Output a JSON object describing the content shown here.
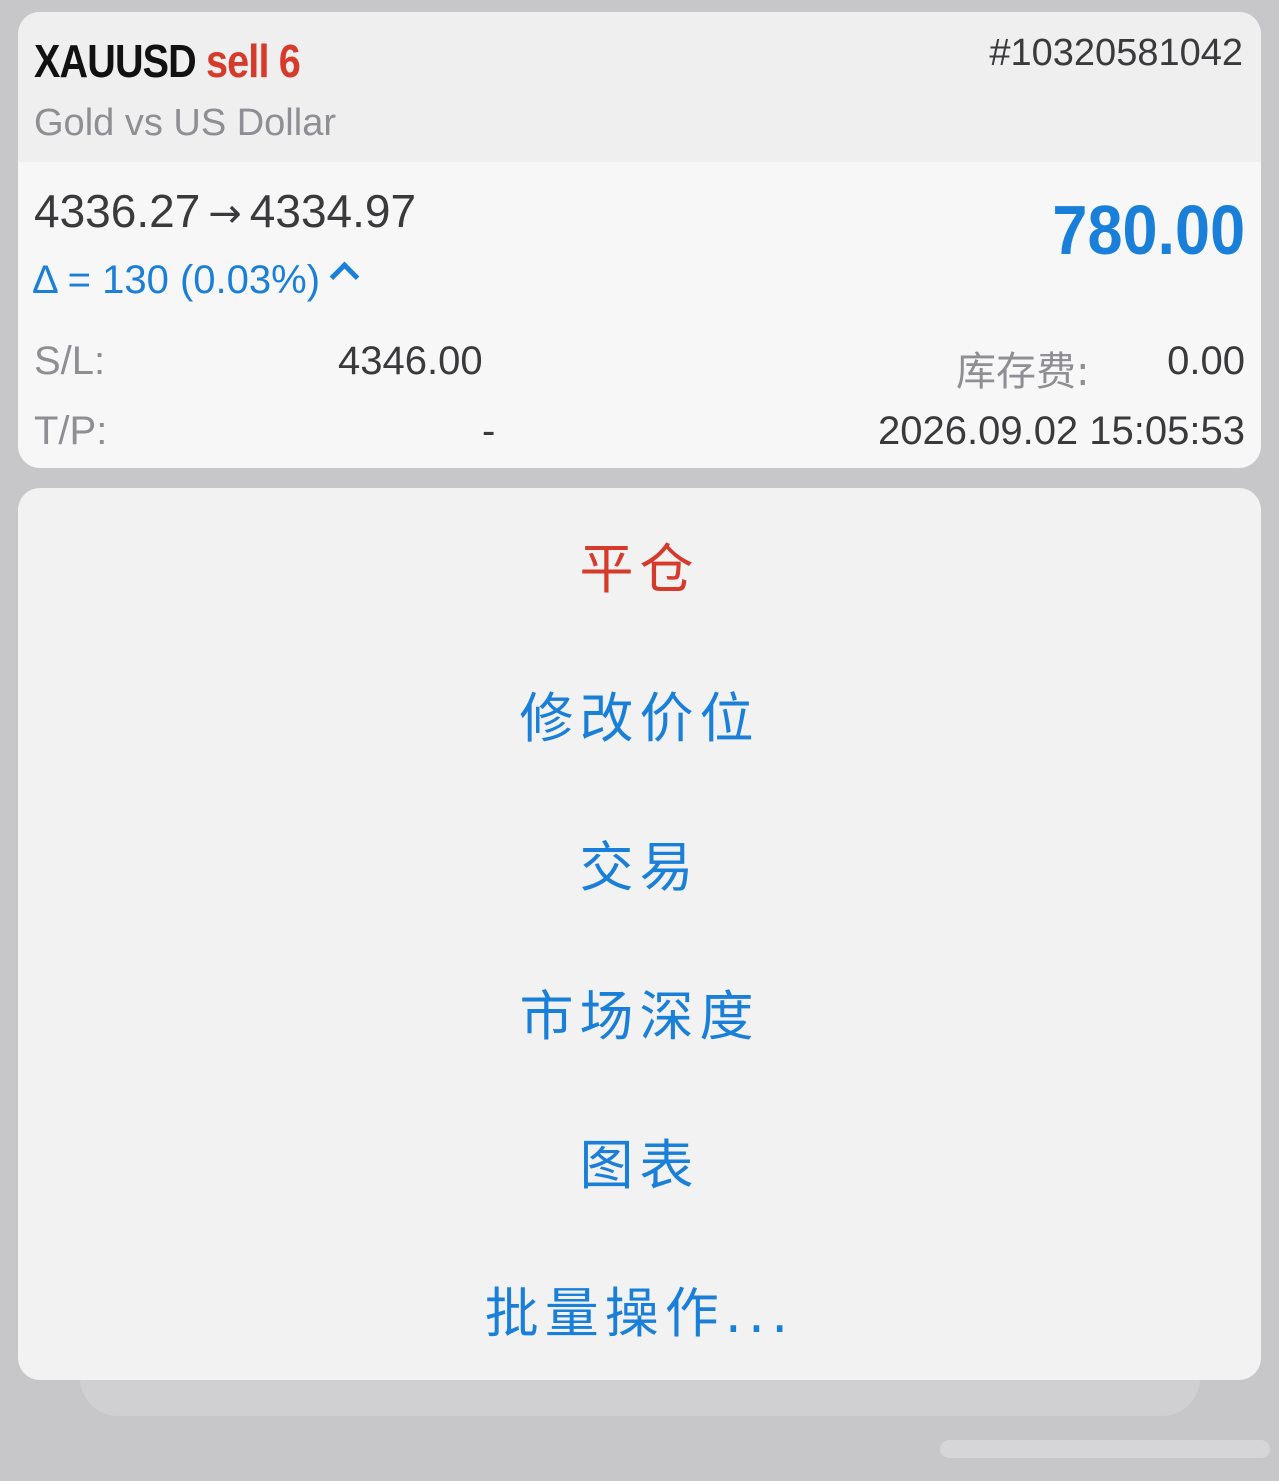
{
  "position": {
    "symbol": "XAUUSD",
    "side_volume": "sell 6",
    "ticket": "#10320581042",
    "description": "Gold vs US Dollar",
    "open_price": "4336.27",
    "arrow": "→",
    "current_price": "4334.97",
    "delta": "Δ = 130 (0.03%)",
    "profit": "780.00",
    "sl_label": "S/L:",
    "sl_value": "4346.00",
    "tp_label": "T/P:",
    "tp_value": "-",
    "swap_label": "库存费:",
    "swap_value": "0.00",
    "open_time": "2026.09.02 15:05:53",
    "colors": {
      "sell": "#d63a2a",
      "profit": "#1a7fd8"
    }
  },
  "actions": [
    {
      "label": "平仓",
      "style": "destructive"
    },
    {
      "label": "修改价位",
      "style": "default"
    },
    {
      "label": "交易",
      "style": "default"
    },
    {
      "label": "市场深度",
      "style": "default"
    },
    {
      "label": "图表",
      "style": "default"
    },
    {
      "label": "批量操作...",
      "style": "default"
    }
  ]
}
